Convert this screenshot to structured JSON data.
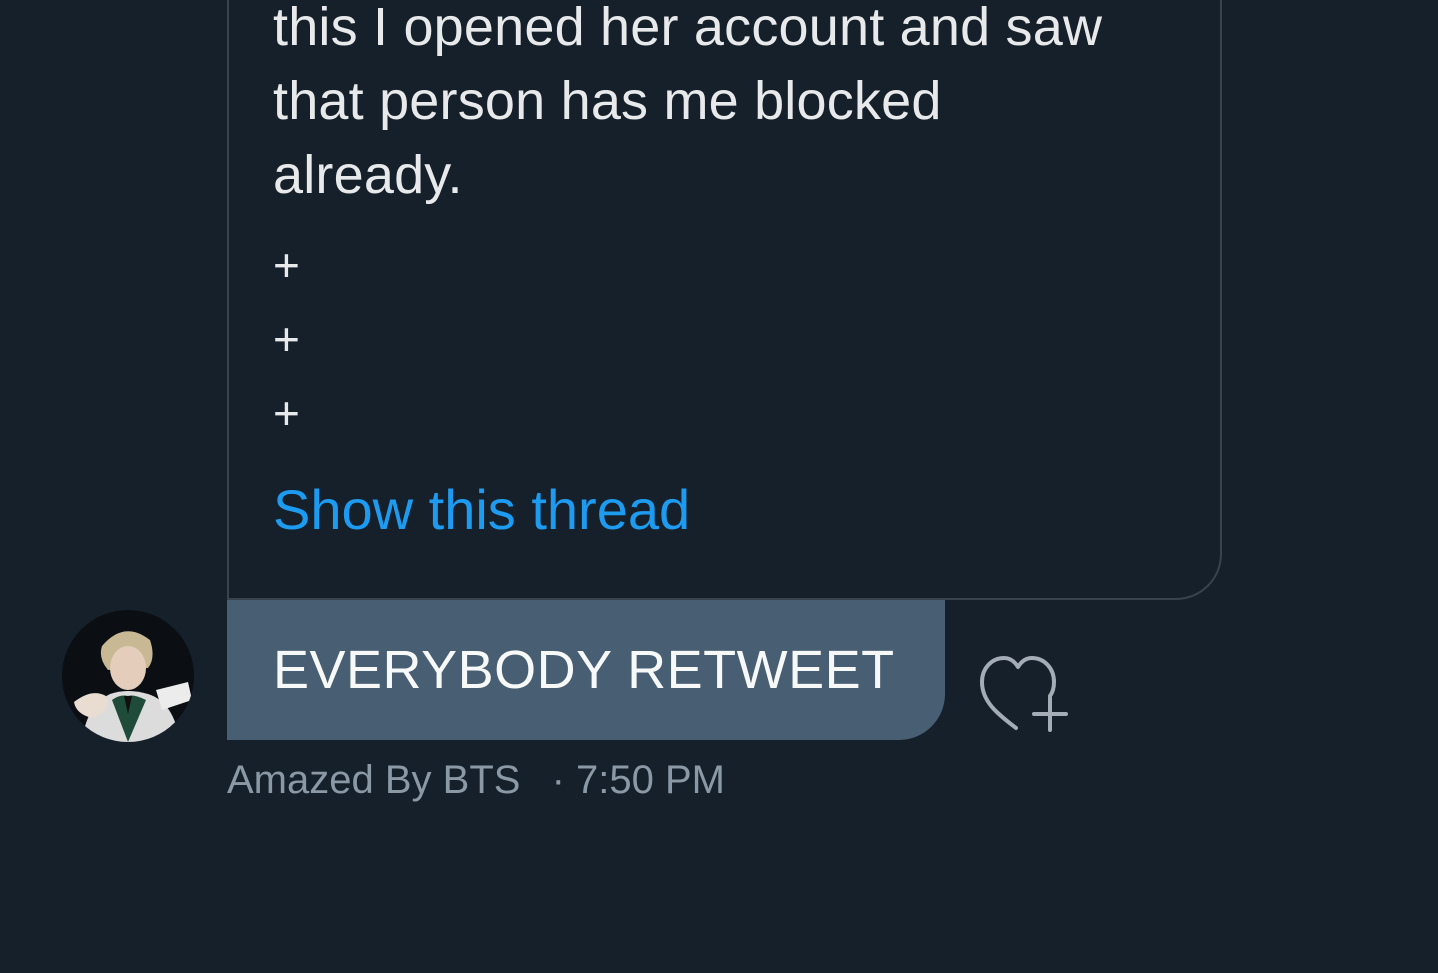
{
  "quoted_tweet": {
    "text": "this I opened her account and saw\nthat person has me blocked\nalready.",
    "separators": [
      "+",
      "+",
      "+"
    ],
    "show_thread_label": "Show this thread"
  },
  "message": {
    "text": "EVERYBODY RETWEET",
    "sender": "Amazed By BTS",
    "separator": "·",
    "time": "7:50 PM"
  },
  "icons": {
    "react": "heart-plus-icon",
    "avatar": "user-avatar"
  },
  "colors": {
    "background": "#15202b",
    "card_border": "#38444d",
    "link": "#1d9bf0",
    "bubble": "#485e73",
    "meta_text": "#8b98a5"
  }
}
